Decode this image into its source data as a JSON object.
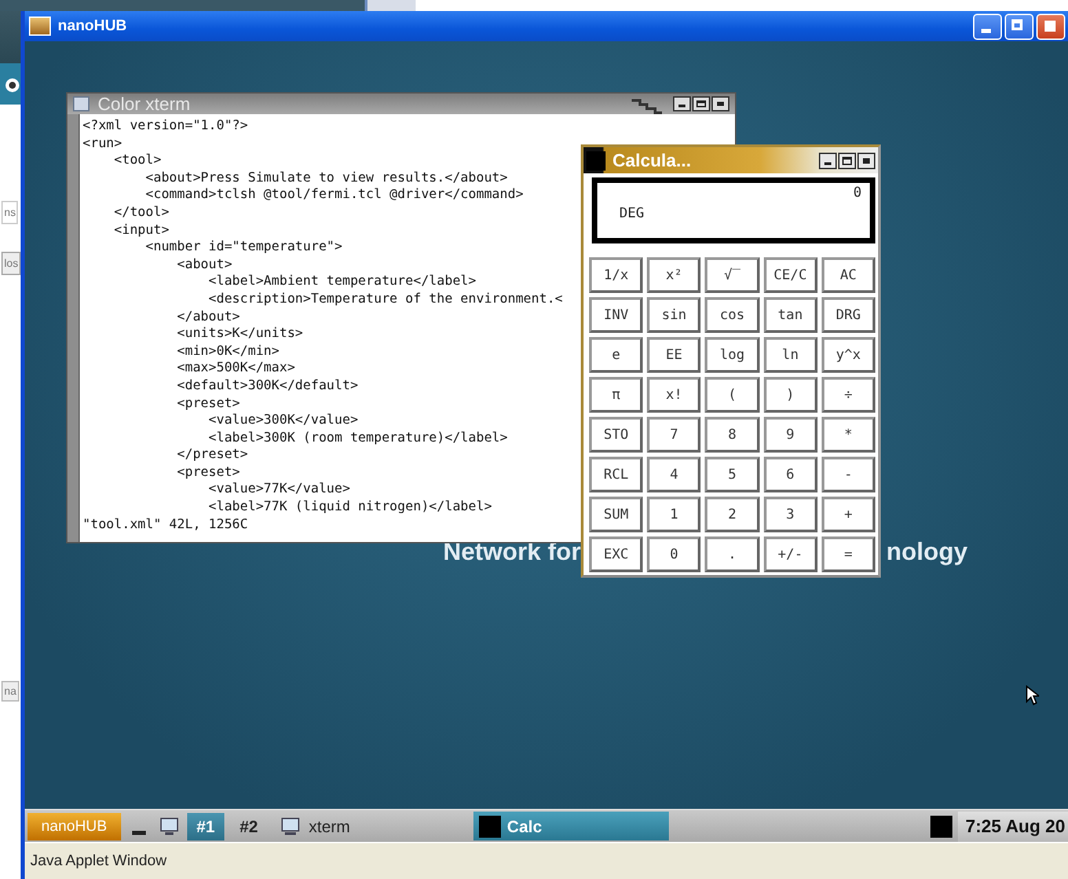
{
  "browser_window": {
    "fragments": [
      "ns",
      "los",
      "na"
    ]
  },
  "window": {
    "title": "nanoHUB"
  },
  "desktop": {
    "background_texts": [
      "Network for",
      "nology"
    ]
  },
  "xterm": {
    "title": "Color xterm",
    "lines": [
      "<?xml version=\"1.0\"?>",
      "<run>",
      "    <tool>",
      "        <about>Press Simulate to view results.</about>",
      "        <command>tclsh @tool/fermi.tcl @driver</command>",
      "    </tool>",
      "    <input>",
      "        <number id=\"temperature\">",
      "            <about>",
      "                <label>Ambient temperature</label>",
      "                <description>Temperature of the environment.<",
      "            </about>",
      "            <units>K</units>",
      "            <min>0K</min>",
      "            <max>500K</max>",
      "            <default>300K</default>",
      "            <preset>",
      "                <value>300K</value>",
      "                <label>300K (room temperature)</label>",
      "            </preset>",
      "            <preset>",
      "                <value>77K</value>",
      "                <label>77K (liquid nitrogen)</label>"
    ],
    "status": "\"tool.xml\" 42L, 1256C"
  },
  "calculator": {
    "title": "Calcula...",
    "display": "0",
    "mode": "DEG",
    "keys": [
      [
        "1/x",
        "x²",
        "√‾",
        "CE/C",
        "AC"
      ],
      [
        "INV",
        "sin",
        "cos",
        "tan",
        "DRG"
      ],
      [
        "e",
        "EE",
        "log",
        "ln",
        "y^x"
      ],
      [
        "π",
        "x!",
        "(",
        ")",
        "÷"
      ],
      [
        "STO",
        "7",
        "8",
        "9",
        "*"
      ],
      [
        "RCL",
        "4",
        "5",
        "6",
        "-"
      ],
      [
        "SUM",
        "1",
        "2",
        "3",
        "+"
      ],
      [
        "EXC",
        "0",
        ".",
        "+/-",
        "="
      ]
    ]
  },
  "taskbar": {
    "menu": "nanoHUB",
    "desktops": [
      {
        "label": "#1",
        "selected": true
      },
      {
        "label": "#2",
        "selected": false
      }
    ],
    "tasks": [
      {
        "label": "xterm",
        "selected": false
      },
      {
        "label": "Calc",
        "selected": true
      }
    ],
    "clock": "7:25 Aug 20"
  },
  "status_bar": "Java Applet Window"
}
